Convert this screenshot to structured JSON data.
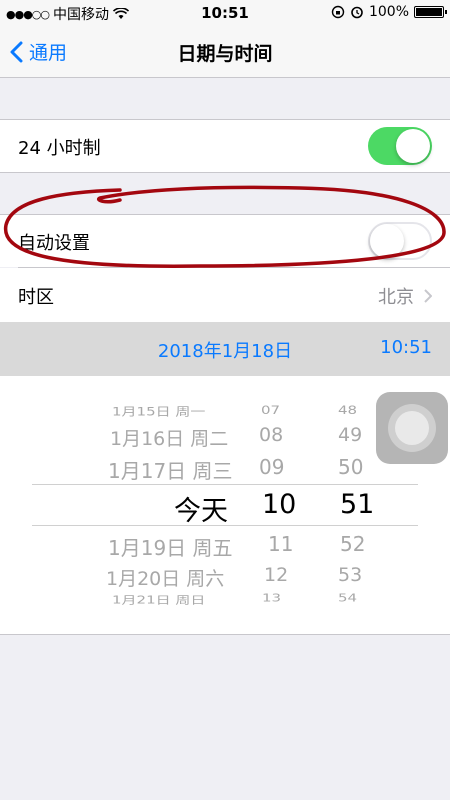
{
  "status_bar": {
    "signal": "●●●○○",
    "carrier": "中国移动",
    "time": "10:51",
    "battery": "100%",
    "battery_level": 1.0
  },
  "nav": {
    "back_label": "通用",
    "title": "日期与时间"
  },
  "settings": {
    "hour24": {
      "label": "24 小时制",
      "on": true
    },
    "auto_set": {
      "label": "自动设置",
      "on": false
    },
    "timezone": {
      "label": "时区",
      "value": "北京"
    }
  },
  "datetime": {
    "date": "2018年1月18日",
    "time": "10:51"
  },
  "picker": {
    "rows": [
      {
        "date": "1月15日 周一",
        "hour": "07",
        "minute": "48"
      },
      {
        "date": "1月16日 周二",
        "hour": "08",
        "minute": "49"
      },
      {
        "date": "1月17日 周三",
        "hour": "09",
        "minute": "50"
      },
      {
        "date": "今天",
        "hour": "10",
        "minute": "51"
      },
      {
        "date": "1月19日 周五",
        "hour": "11",
        "minute": "52"
      },
      {
        "date": "1月20日 周六",
        "hour": "12",
        "minute": "53"
      },
      {
        "date": "1月21日 周日",
        "hour": "13",
        "minute": "54"
      }
    ]
  },
  "colors": {
    "accent": "#0a7aff",
    "toggle_on": "#4cd964",
    "annotation": "#a3070f"
  }
}
